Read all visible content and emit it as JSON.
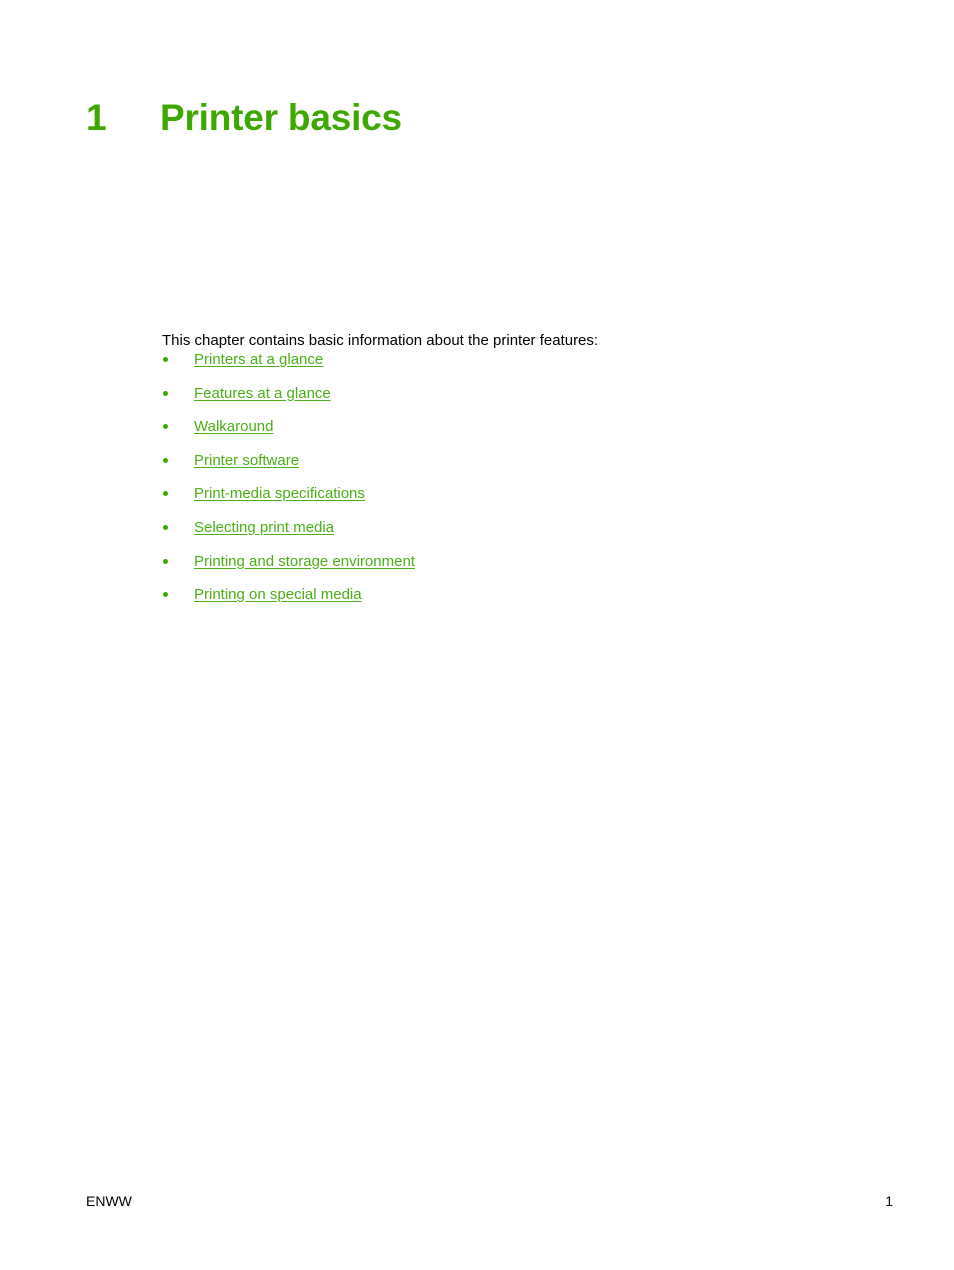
{
  "document": {
    "type": "printed-manual-page",
    "background_color": "#ffffff",
    "accent_green": "#3da900",
    "link_green": "#4caf17",
    "body_color": "#000000"
  },
  "heading": {
    "number": "1",
    "title": "Printer basics"
  },
  "intro": {
    "text": "This chapter contains basic information about the printer features:"
  },
  "toc": {
    "bullet_glyph": "bullet-icon",
    "items": [
      {
        "label": "Printers at a glance"
      },
      {
        "label": "Features at a glance"
      },
      {
        "label": "Walkaround"
      },
      {
        "label": "Printer software"
      },
      {
        "label": "Print-media specifications"
      },
      {
        "label": "Selecting print media"
      },
      {
        "label": "Printing and storage environment"
      },
      {
        "label": "Printing on special media"
      }
    ]
  },
  "footer": {
    "left": "ENWW",
    "right": "1"
  }
}
